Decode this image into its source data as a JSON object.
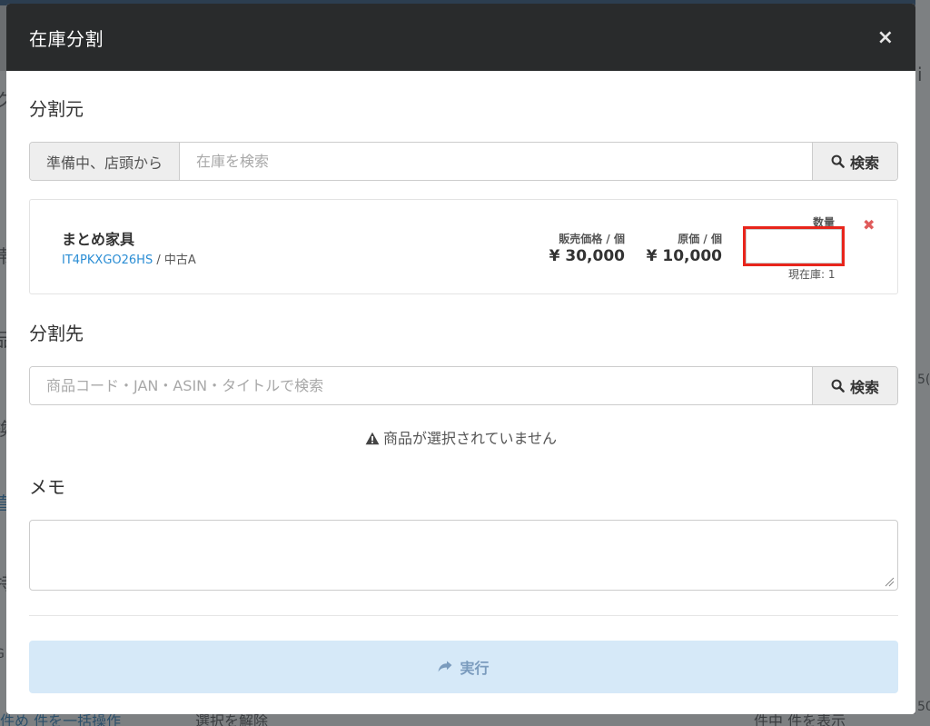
{
  "background": {
    "left_chars": [
      "ク",
      "帯",
      "品",
      "換",
      "直",
      "特",
      "G"
    ],
    "bottom_texts": [
      "件め 件を一括操作",
      "選択を解除",
      "件中 件を表示"
    ],
    "right_chars": [
      "i",
      "5(",
      "50"
    ]
  },
  "modal": {
    "title": "在庫分割",
    "close_label": "×"
  },
  "source": {
    "title": "分割元",
    "addon_label": "準備中、店頭から",
    "search_placeholder": "在庫を検索",
    "search_button": "検索"
  },
  "item": {
    "name": "まとめ家具",
    "code": "IT4PKXGO26HS",
    "separator": " / ",
    "condition": "中古A",
    "sale_price_label": "販売価格 / 個",
    "sale_price": "¥ 30,000",
    "cost_price_label": "原価 / 個",
    "cost_price": "¥ 10,000",
    "quantity_label": "数量",
    "quantity_value": "",
    "stock_text": "現在庫: 1",
    "remove_label": "✖"
  },
  "destination": {
    "title": "分割先",
    "search_placeholder": "商品コード・JAN・ASIN・タイトルで検索",
    "search_button": "検索",
    "empty_message": "商品が選択されていません"
  },
  "memo": {
    "title": "メモ",
    "value": ""
  },
  "actions": {
    "run_label": "実行"
  },
  "colors": {
    "header_bg": "#292b2c",
    "link": "#2a8dd4",
    "highlight_border": "#e8251c",
    "remove": "#e05b5b",
    "run_button_bg": "#d6e9f8"
  }
}
